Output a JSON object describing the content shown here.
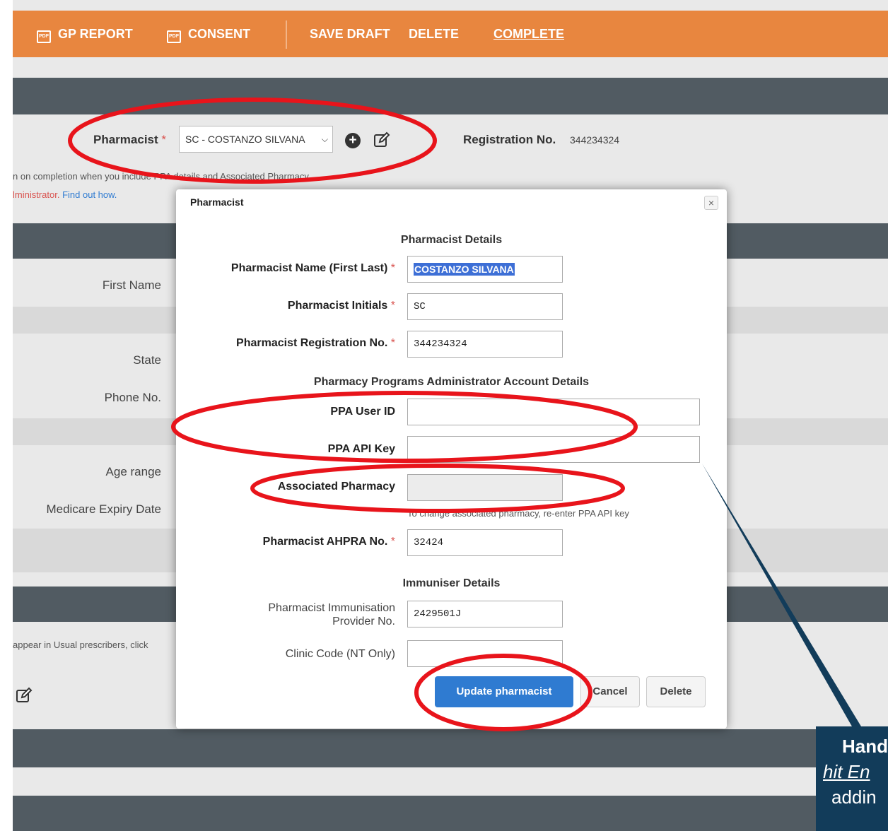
{
  "toolbar": {
    "gp_report": "GP REPORT",
    "consent": "CONSENT",
    "save_draft": "SAVE DRAFT",
    "delete": "DELETE",
    "complete": "COMPLETE",
    "pdf_badge": "PDF"
  },
  "background_form": {
    "pharmacist_label": "Pharmacist",
    "required_mark": "*",
    "pharmacist_selected": "SC - COSTANZO SILVANA",
    "registration_label": "Registration No.",
    "registration_value": "344234324",
    "info_line": "n on completion when you include PPA details and Associated Pharmacy.",
    "admin_text": "lministrator.",
    "find_out_link": "Find out how.",
    "first_name": "First Name",
    "state": "State",
    "phone": "Phone No.",
    "age_range": "Age range",
    "medicare_expiry": "Medicare Expiry Date",
    "prescribers_text": "appear in Usual prescribers, click"
  },
  "modal": {
    "title": "Pharmacist",
    "close_symbol": "×",
    "section_details": "Pharmacist Details",
    "name_label": "Pharmacist Name (First Last)",
    "name_value": "COSTANZO SILVANA",
    "initials_label": "Pharmacist Initials",
    "initials_value": "SC",
    "reg_label": "Pharmacist Registration No.",
    "reg_value": "344234324",
    "section_ppa": "Pharmacy Programs Administrator Account Details",
    "ppa_user_label": "PPA User ID",
    "ppa_user_value": "",
    "ppa_api_label": "PPA API Key",
    "ppa_api_value": "",
    "assoc_label": "Associated Pharmacy",
    "assoc_value": "",
    "assoc_helper": "To change associated pharmacy, re-enter PPA API key",
    "ahpra_label": "Pharmacist AHPRA No.",
    "ahpra_value": "32424",
    "section_immuniser": "Immuniser Details",
    "immun_label_1": "Pharmacist Immunisation",
    "immun_label_2": "Provider No.",
    "immun_value": "2429501J",
    "clinic_label": "Clinic Code (NT Only)",
    "clinic_value": "",
    "update_button": "Update pharmacist",
    "cancel_button": "Cancel",
    "delete_button": "Delete"
  },
  "callout": {
    "line1": "Hand",
    "line2": "hit En",
    "line3": "addin"
  },
  "colors": {
    "toolbar": "#e8863f",
    "band": "#515b62",
    "primary": "#2f7bd1",
    "annotation": "#e8141b",
    "callout": "#123c5a"
  }
}
